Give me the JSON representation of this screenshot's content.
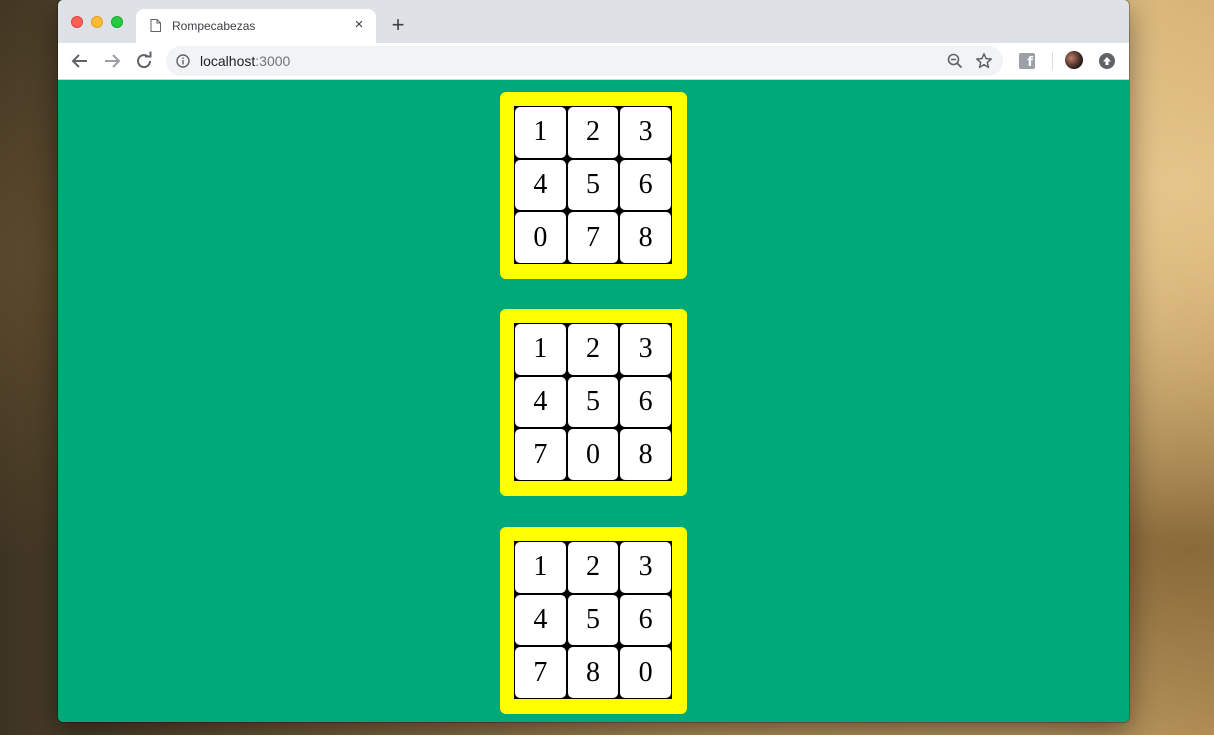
{
  "browser": {
    "tab": {
      "title": "Rompecabezas",
      "close": "×"
    },
    "new_tab": "+",
    "address_bar": {
      "host": "localhost",
      "port": ":3000"
    }
  },
  "puzzles": [
    {
      "tiles": [
        "1",
        "2",
        "3",
        "4",
        "5",
        "6",
        "0",
        "7",
        "8"
      ]
    },
    {
      "tiles": [
        "1",
        "2",
        "3",
        "4",
        "5",
        "6",
        "7",
        "0",
        "8"
      ]
    },
    {
      "tiles": [
        "1",
        "2",
        "3",
        "4",
        "5",
        "6",
        "7",
        "8",
        "0"
      ]
    }
  ],
  "colors": {
    "page_background": "#00aa78",
    "board_frame": "#ffff00",
    "tile": "#ffffff",
    "grid_lines": "#000000"
  },
  "icons": [
    "page-icon",
    "back-arrow-icon",
    "forward-arrow-icon",
    "reload-icon",
    "info-icon",
    "zoom-out-icon",
    "star-icon",
    "facebook-icon",
    "profile-avatar",
    "update-icon"
  ]
}
